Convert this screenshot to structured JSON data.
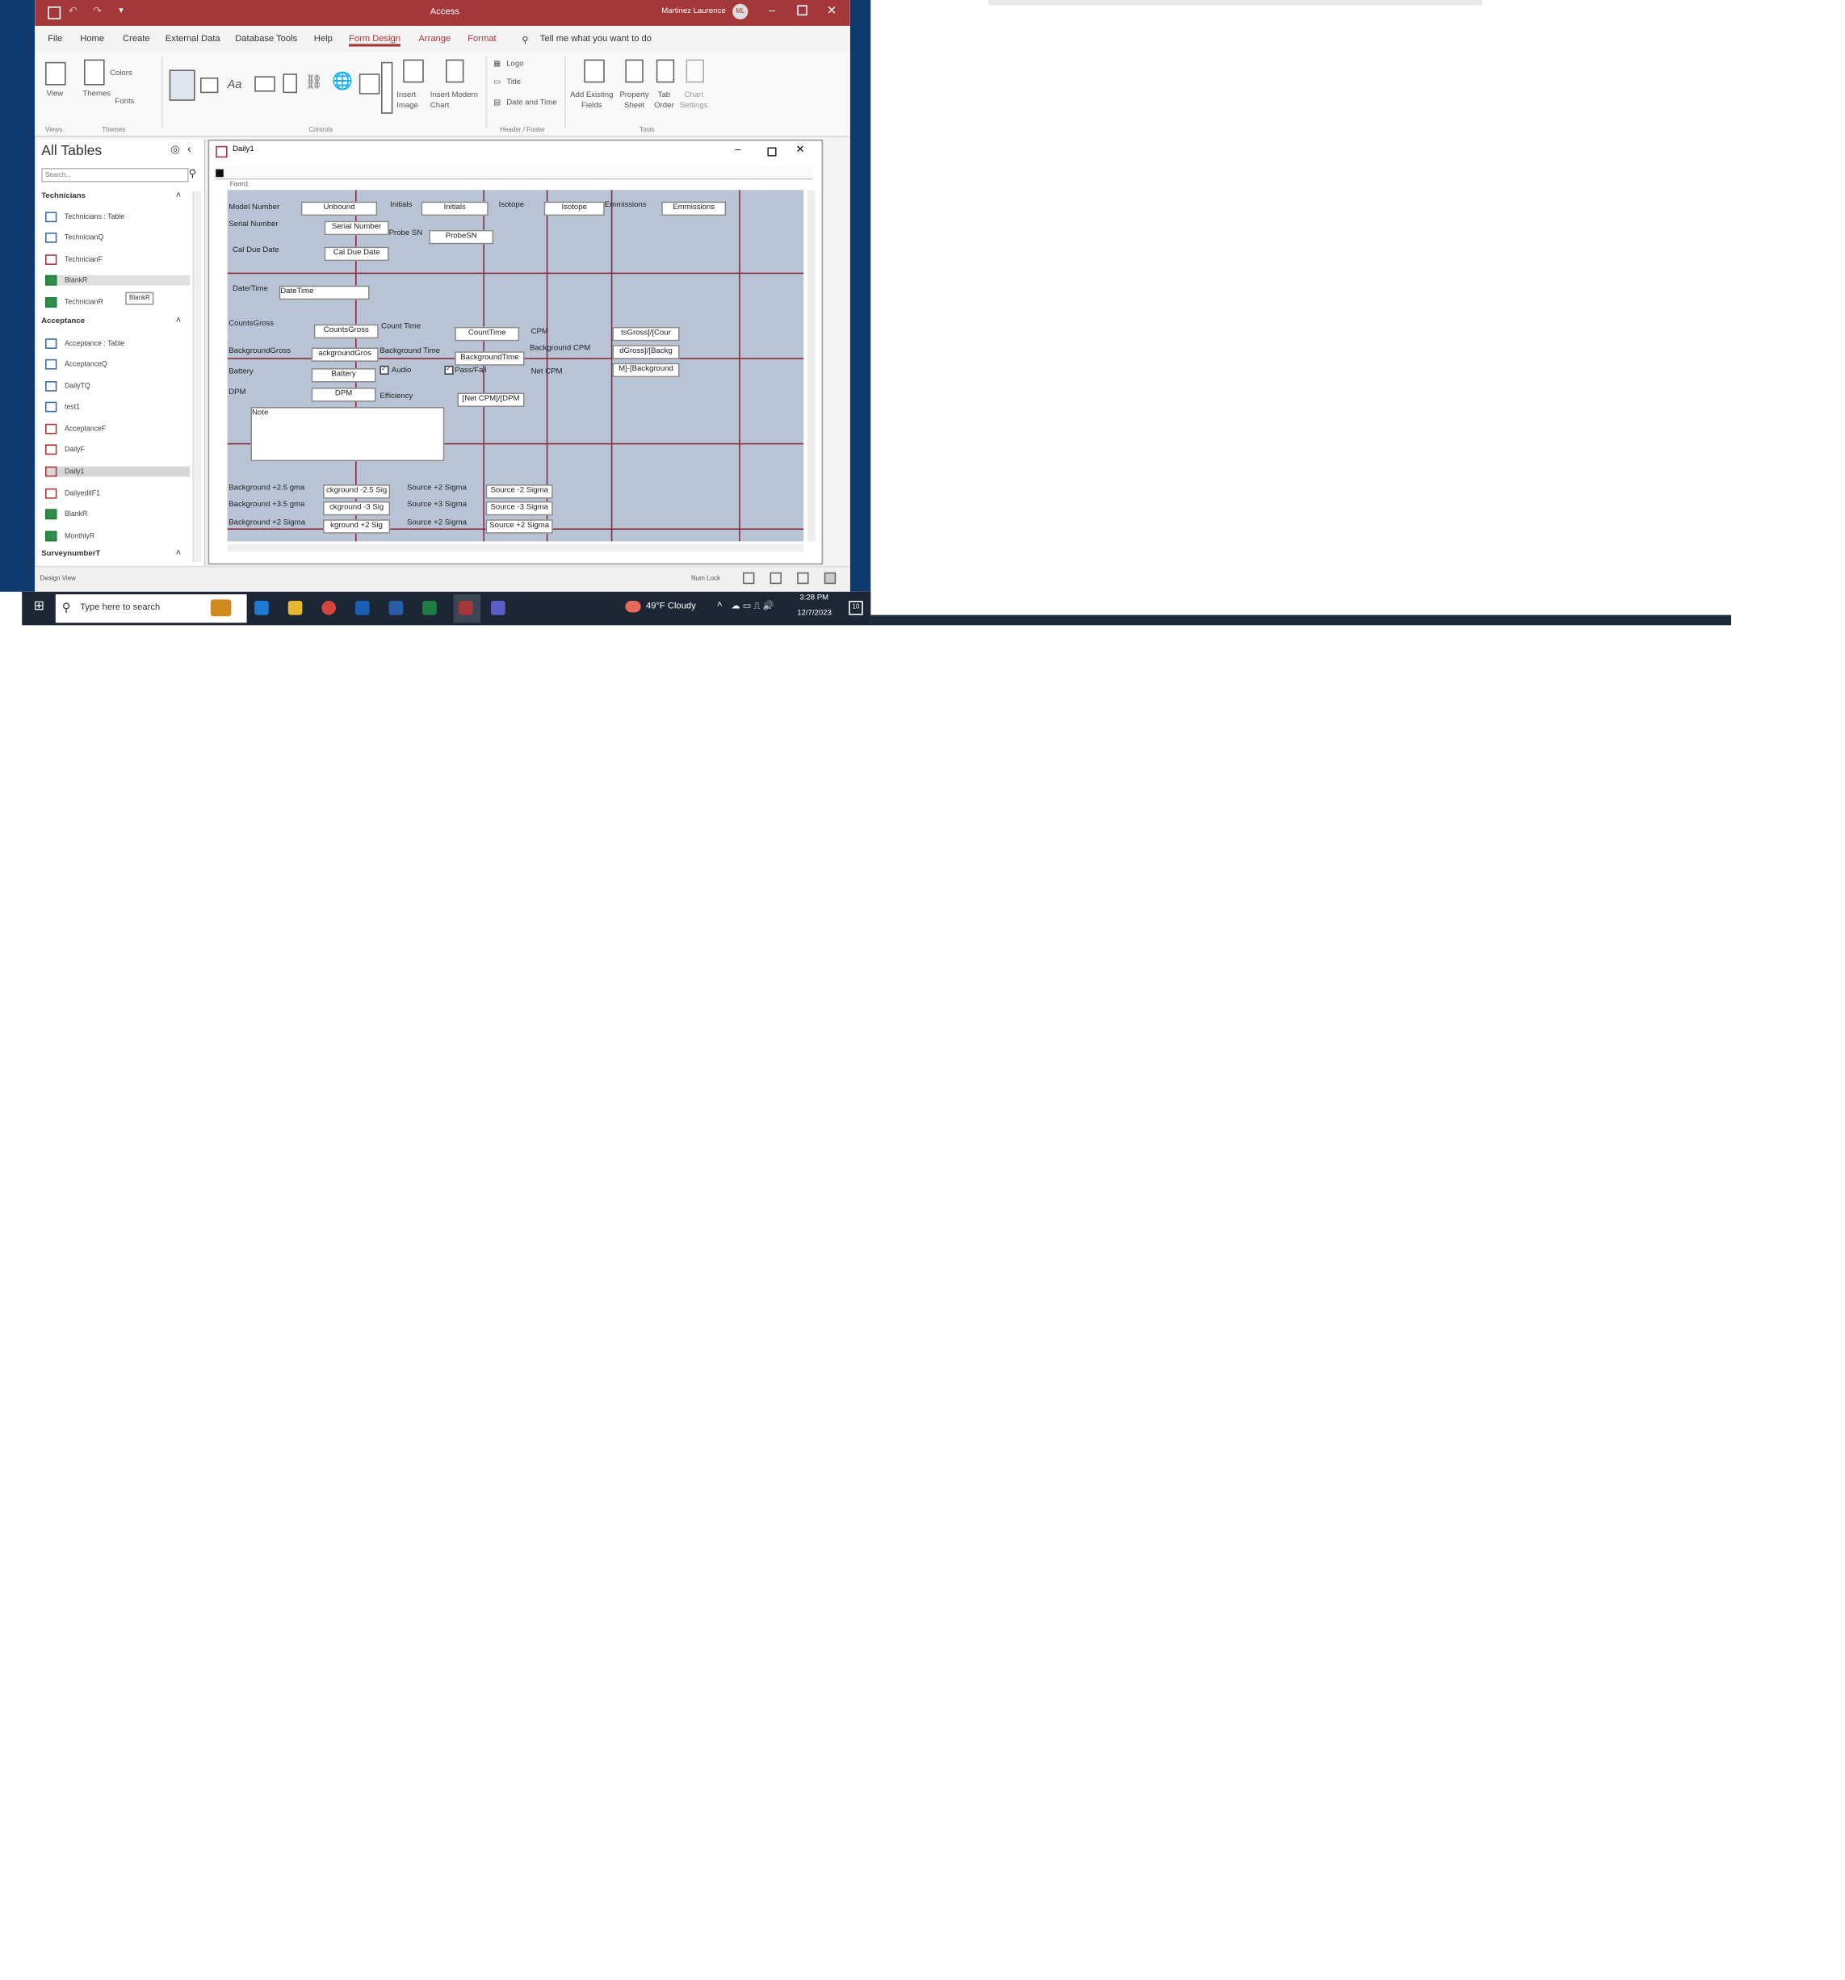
{
  "app": {
    "title": "Access",
    "user": "Martinez Laurence",
    "user_initials": "ML"
  },
  "menu": [
    "File",
    "Home",
    "Create",
    "External Data",
    "Database Tools",
    "Help",
    "Form Design",
    "Arrange",
    "Format"
  ],
  "tell_me": "Tell me what you want to do",
  "ribbon": {
    "view": "View",
    "themes": "Themes",
    "colors": "Colors",
    "fonts": "Fonts",
    "insert_image": "Insert Image",
    "insert_chart": "Insert Modern Chart",
    "logo": "Logo",
    "title": "Title",
    "date_time": "Date and Time",
    "add_fields": "Add Existing Fields",
    "property_sheet": "Property Sheet",
    "tab_order": "Tab Order",
    "chart_settings": "Chart Settings",
    "groups": [
      "Views",
      "Themes",
      "Controls",
      "Header / Footer",
      "Tools"
    ]
  },
  "nav": {
    "title": "All Tables",
    "search_placeholder": "Search...",
    "groups": [
      {
        "name": "Technicians",
        "items": [
          "Technicians : Table",
          "TechnicianQ",
          "TechnicianF",
          "BlankR",
          "TechnicianR"
        ]
      },
      {
        "name": "Acceptance",
        "items": [
          "Acceptance : Table",
          "AcceptanceQ",
          "DailyTQ",
          "test1",
          "AcceptanceF",
          "DailyF",
          "Daily1",
          "DailyeditF1",
          "BlankR",
          "MonthlyR"
        ]
      },
      {
        "name": "SurveynumberT",
        "items": []
      }
    ],
    "tooltip": "BlankR"
  },
  "document": {
    "tab_title": "Daily1",
    "section": "Form1"
  },
  "form": {
    "labels": [
      "Model Number",
      "Initials",
      "Isotope",
      "Emmissions",
      "Serial Number",
      "Probe SN",
      "Cal Due Date",
      "Date/Time",
      "CountsGross",
      "Count Time",
      "CPM",
      "BackgroundGross",
      "Background Time",
      "Background CPM",
      "Battery",
      "Audio",
      "Pass/Fail",
      "Net CPM",
      "DPM",
      "Efficiency",
      "Note",
      "Background +2.5 gma",
      "Background +3.5 gma",
      "Background +2 Sigma",
      "Source +2 Sigma",
      "Source +3 Sigma",
      "Source +2 Sigma"
    ],
    "boxes": [
      "Unbound",
      "Initials",
      "Isotope",
      "Emmissions",
      "Serial Number",
      "ProbeSN",
      "Cal Due Date",
      "DateTime",
      "CountsGross",
      "CountTime",
      "tsGross]/[Cour",
      "ackgroundGros",
      "BackgroundTime",
      "dGross]/[Backg",
      "M]-[Background",
      "Battery",
      "DPM",
      "[Net CPM]/[DPM",
      "ckground -2.5 Sig",
      "ckground -3 Sig",
      "kground +2 Sig",
      "Source -2 Sigma",
      "Source -3 Sigma",
      "Source +2 Sigma"
    ]
  },
  "status": {
    "left": "Design View",
    "numlock": "Num Lock"
  },
  "taskbar": {
    "search": "Type here to search",
    "weather": "49°F Cloudy",
    "time": "3:28 PM",
    "date": "12/7/2023",
    "notif": "10"
  }
}
